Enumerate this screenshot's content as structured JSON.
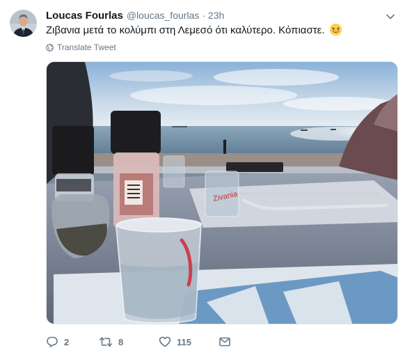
{
  "tweet": {
    "author_name": "Loucas Fourlas",
    "author_handle": "@loucas_fourlas",
    "separator": "·",
    "timestamp": "23h",
    "text": "Ζιβανια μετά το κολύμπι στη Λεμεσό ότι καλύτερο. Κόπιαστε.",
    "emoji": "grinning-squinting-face",
    "translate_label": "Translate Tweet",
    "media_alt": "Photo of a zivania shot glass and condiments on a seaside table",
    "glass_print": "Zivania"
  },
  "actions": {
    "replies": "2",
    "retweets": "8",
    "likes": "115"
  },
  "icons": {
    "caret": "chevron-down-icon",
    "translate": "globe-icon",
    "reply": "reply-icon",
    "retweet": "retweet-icon",
    "like": "heart-icon",
    "dm": "envelope-icon"
  },
  "colors": {
    "text": "#14171a",
    "secondary": "#657786",
    "border": "#e1e8ed"
  }
}
